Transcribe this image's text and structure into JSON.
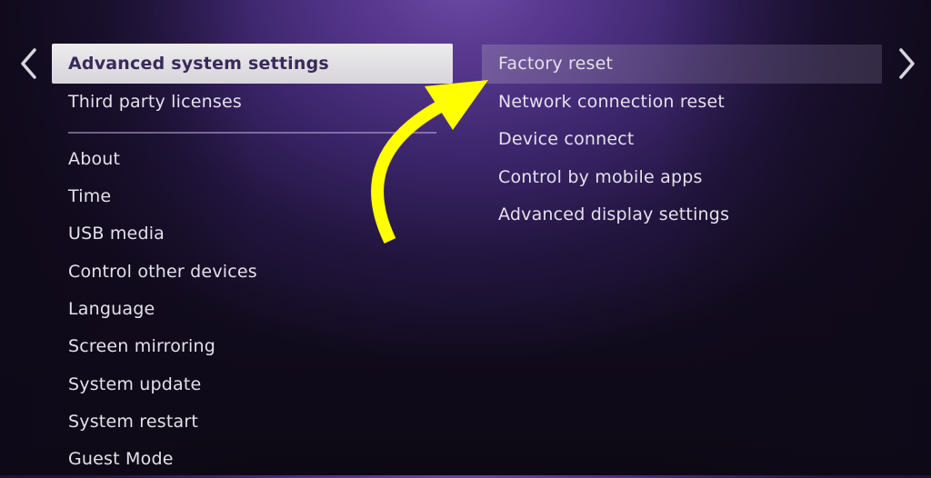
{
  "navigation": {
    "back_icon": "chevron-left-icon",
    "forward_icon": "chevron-right-icon"
  },
  "left_menu": {
    "items": [
      {
        "label": "Advanced system settings",
        "state": "focused"
      },
      {
        "label": "Third party licenses"
      }
    ],
    "items_after_divider": [
      {
        "label": "About"
      },
      {
        "label": "Time"
      },
      {
        "label": "USB media"
      },
      {
        "label": "Control other devices"
      },
      {
        "label": "Language"
      },
      {
        "label": "Screen mirroring"
      },
      {
        "label": "System update"
      },
      {
        "label": "System restart"
      },
      {
        "label": "Guest Mode"
      }
    ]
  },
  "right_menu": {
    "items": [
      {
        "label": "Factory reset",
        "state": "selected"
      },
      {
        "label": "Network connection reset"
      },
      {
        "label": "Device connect"
      },
      {
        "label": "Control by mobile apps"
      },
      {
        "label": "Advanced display settings"
      }
    ]
  },
  "annotation": {
    "type": "curved-arrow",
    "points_to": "Factory reset",
    "color": "#ffff00"
  },
  "colors": {
    "focus_bg": "#e6e5e8",
    "focus_text": "#3a2a5a",
    "menu_text": "#e4e1ea",
    "bg_purple": "#6c4aa4",
    "bg_dark": "#0e0a17"
  }
}
